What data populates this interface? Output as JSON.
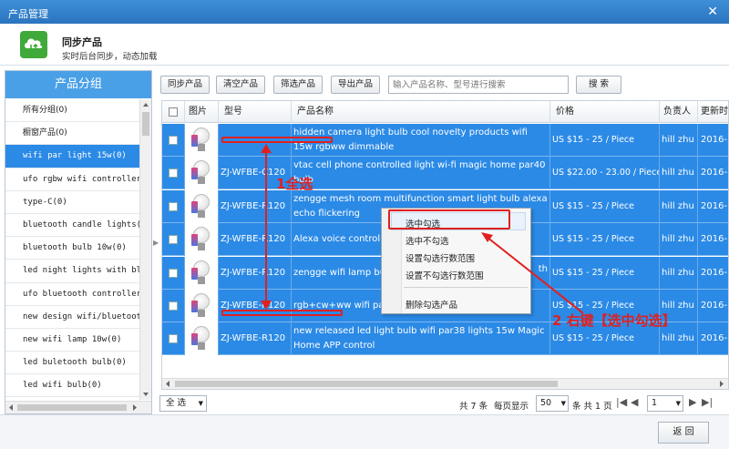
{
  "window": {
    "title": "产品管理",
    "close_glyph": "✕"
  },
  "sync": {
    "title": "同步产品",
    "subtitle": "实时后台同步，动态加载"
  },
  "sidebar": {
    "title": "产品分组",
    "items": [
      {
        "label": "所有分组(0)",
        "cjk": true
      },
      {
        "label": "橱窗产品(0)",
        "cjk": true
      },
      {
        "label": "wifi par light 15w(0)",
        "active": true
      },
      {
        "label": "ufo rgbw wifi controller(0"
      },
      {
        "label": "type-C(0)"
      },
      {
        "label": "bluetooth candle lights(0)"
      },
      {
        "label": "bluetooth bulb 10w(0)"
      },
      {
        "label": "led night lights with blue"
      },
      {
        "label": "ufo bluetooth controller r"
      },
      {
        "label": "new design wifi/bluetooth"
      },
      {
        "label": "new wifi lamp 10w(0)"
      },
      {
        "label": "led buletooth bulb(0)"
      },
      {
        "label": "led wifi bulb(0)"
      }
    ]
  },
  "toolbar": {
    "buttons": [
      "同步产品",
      "清空产品",
      "筛选产品",
      "导出产品"
    ],
    "search_placeholder": "输入产品名称、型号进行搜索",
    "search_button": "搜 索"
  },
  "grid": {
    "headers": {
      "image": "图片",
      "model": "型号",
      "name": "产品名称",
      "price": "价格",
      "owner": "负责人",
      "updated": "更新时"
    },
    "rows": [
      {
        "model": "",
        "name": "hidden camera light bulb cool novelty products wifi 15w rgbww dimmable",
        "price": "US $15 - 25 / Piece",
        "owner": "hill zhu",
        "date": "2016-"
      },
      {
        "model": "ZJ-WFBE-C120",
        "name": "vtac cell phone controlled light wi-fi magic home par40 bulb",
        "price": "US $22.00 - 23.00 / Piece",
        "owner": "hill zhu",
        "date": "2016-"
      },
      {
        "model": "ZJ-WFBE-R120",
        "name": "zengge mesh room multifunction smart light bulb alexa echo flickering",
        "price": "US $15 - 25 / Piece",
        "owner": "hill zhu",
        "date": "2016-"
      },
      {
        "model": "ZJ-WFBE-R120",
        "name": "Alexa voice control wi",
        "price": "US $15 - 25 / Piece",
        "owner": "hill zhu",
        "date": "2016-"
      },
      {
        "model": "ZJ-WFBE-R120",
        "name": "zengge wifi lamp bul sunrise sunset par 40",
        "name_tail": "th",
        "price": "US $15 - 25 / Piece",
        "owner": "hill zhu",
        "date": "2016-"
      },
      {
        "model": "ZJ-WFBE-R120",
        "name": "rgb+cw+ww wifi par",
        "price": "US $15 - 25 / Piece",
        "owner": "hill zhu",
        "date": "2016-"
      },
      {
        "model": "ZJ-WFBE-R120",
        "name": "new released led light bulb wifi par38 lights 15w Magic Home APP control",
        "price": "US $15 - 25 / Piece",
        "owner": "hill zhu",
        "date": "2016-"
      }
    ]
  },
  "context_menu": {
    "items": [
      "选中勾选",
      "选中不勾选",
      "设置勾选行数范围",
      "设置不勾选行数范围",
      "删除勾选产品"
    ]
  },
  "footer": {
    "select_all": "全 选",
    "total": "共 7 条",
    "per_page_label": "每页显示",
    "per_page": "50",
    "pages": "条 共 1 页",
    "current_page": "1"
  },
  "bottom": {
    "back_button": "返 回"
  },
  "annotations": {
    "select_all_note": "1全选",
    "right_click_note": "2 右键【选中勾选】"
  },
  "colors": {
    "selected_row": "#2b8ae6",
    "annotation": "#e02020",
    "titlebar": "#2b74c0"
  }
}
